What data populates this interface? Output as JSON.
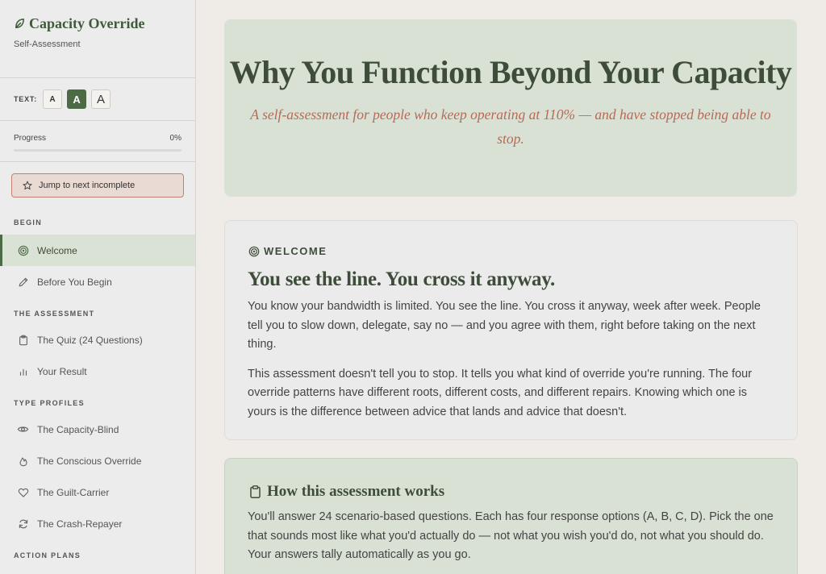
{
  "sidebar": {
    "brand_title": "Capacity Override",
    "brand_subtitle": "Self-Assessment",
    "text_size": {
      "label": "TEXT:",
      "small": "A",
      "medium": "A",
      "large": "A",
      "active": "medium"
    },
    "progress": {
      "label": "Progress",
      "value_text": "0%",
      "fraction": 0
    },
    "jump_label": "Jump to next incomplete",
    "sections": [
      {
        "label": "BEGIN",
        "items": [
          {
            "label": "Welcome",
            "icon": "target-icon",
            "active": true
          },
          {
            "label": "Before You Begin",
            "icon": "pencil-icon"
          }
        ]
      },
      {
        "label": "THE ASSESSMENT",
        "items": [
          {
            "label": "The Quiz (24 Questions)",
            "icon": "clipboard-icon"
          },
          {
            "label": "Your Result",
            "icon": "bar-chart-icon"
          }
        ]
      },
      {
        "label": "TYPE PROFILES",
        "items": [
          {
            "label": "The Capacity-Blind",
            "icon": "eye-icon"
          },
          {
            "label": "The Conscious Override",
            "icon": "flame-icon"
          },
          {
            "label": "The Guilt-Carrier",
            "icon": "heart-icon"
          },
          {
            "label": "The Crash-Repayer",
            "icon": "refresh-icon"
          }
        ]
      },
      {
        "label": "ACTION PLANS",
        "items": []
      }
    ]
  },
  "hero": {
    "title": "Why You Function Beyond Your Capacity",
    "subtitle": "A self-assessment for people who keep operating at 110% — and have stopped being able to stop."
  },
  "welcome": {
    "eyebrow": "WELCOME",
    "heading": "You see the line. You cross it anyway.",
    "p1": "You know your bandwidth is limited. You see the line. You cross it anyway, week after week. People tell you to slow down, delegate, say no — and you agree with them, right before taking on the next thing.",
    "p2": "This assessment doesn't tell you to stop. It tells you what kind of override you're running. The four override patterns have different roots, different costs, and different repairs. Knowing which one is yours is the difference between advice that lands and advice that doesn't."
  },
  "how": {
    "title": "How this assessment works",
    "p1": "You'll answer 24 scenario-based questions. Each has four response options (A, B, C, D). Pick the one that sounds most like what you'd actually do — not what you wish you'd do, not what you should do. Your answers tally automatically as you go."
  },
  "colors": {
    "accent": "#4b6a45",
    "accent_soft": "#d9e1d5",
    "subtitle": "#b86a55",
    "jump_border": "#c28175"
  }
}
